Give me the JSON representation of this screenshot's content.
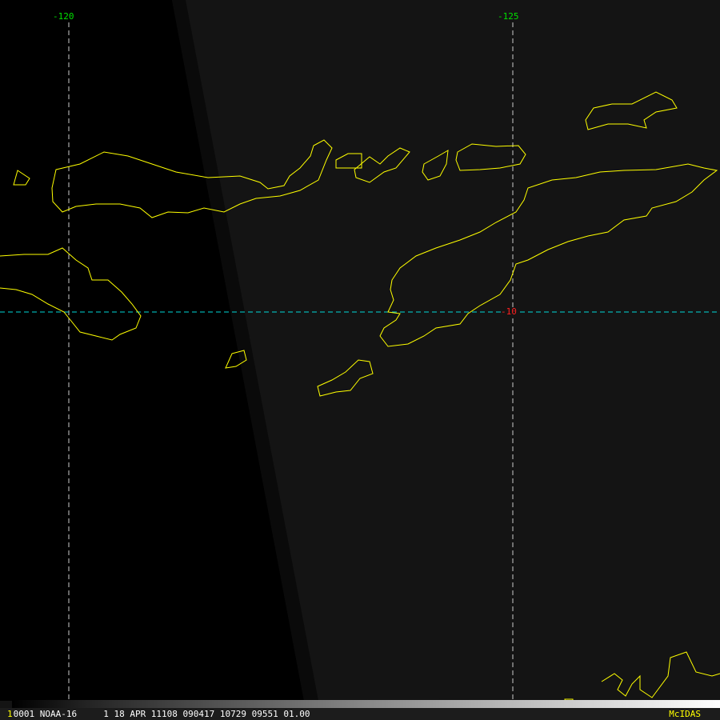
{
  "map": {
    "longitude_labels": [
      "-120",
      "-125"
    ],
    "latitude_labels": [
      "-10"
    ],
    "colors": {
      "coast": "#ffff00",
      "grid": "#cccccc",
      "lat_line": "#00d8d8",
      "lon_label": "#00e000",
      "lat_label": "#ff2020"
    }
  },
  "status": {
    "frame": "1",
    "info": "0001 NOAA-16     1 18 APR 11108 090417 10729 09551 01.00",
    "brand": "McIDAS"
  }
}
